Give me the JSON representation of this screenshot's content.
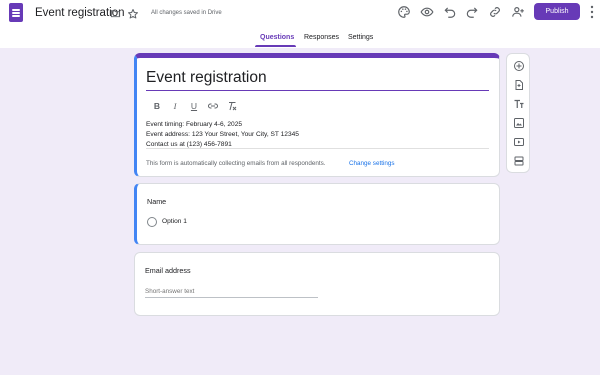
{
  "header": {
    "doc_title": "Event registration",
    "saved_status": "All changes saved in Drive",
    "publish_label": "Publish",
    "icons": [
      "forms-app-icon",
      "folder-icon",
      "star-icon",
      "palette-icon",
      "preview-icon",
      "undo-icon",
      "redo-icon",
      "link-icon",
      "add-collaborator-icon",
      "more-vert-icon"
    ]
  },
  "tabs": [
    {
      "label": "Questions",
      "active": true
    },
    {
      "label": "Responses",
      "active": false
    },
    {
      "label": "Settings",
      "active": false
    }
  ],
  "form": {
    "title": "Event registration",
    "format_tools": [
      "bold",
      "italic",
      "underline",
      "link",
      "clear-formatting"
    ],
    "description_lines": [
      "Event timing: February 4-6, 2025",
      "Event address: 123 Your Street, Your City, ST 12345",
      "Contact us at (123) 456-7891"
    ],
    "email_notice": "This form is automatically collecting emails from all respondents.",
    "change_settings_label": "Change settings"
  },
  "questions": [
    {
      "title": "Name",
      "type": "multiple-choice",
      "options": [
        "Option 1"
      ]
    },
    {
      "title": "Email address",
      "type": "short-answer",
      "placeholder": "Short-answer text"
    }
  ],
  "side_toolbar": [
    "add-question-icon",
    "import-questions-icon",
    "add-title-icon",
    "add-image-icon",
    "add-video-icon",
    "add-section-icon"
  ],
  "colors": {
    "accent": "#673ab7",
    "background": "#f0ebf8",
    "active_question_bar": "#4285f4",
    "link": "#1a73e8"
  }
}
